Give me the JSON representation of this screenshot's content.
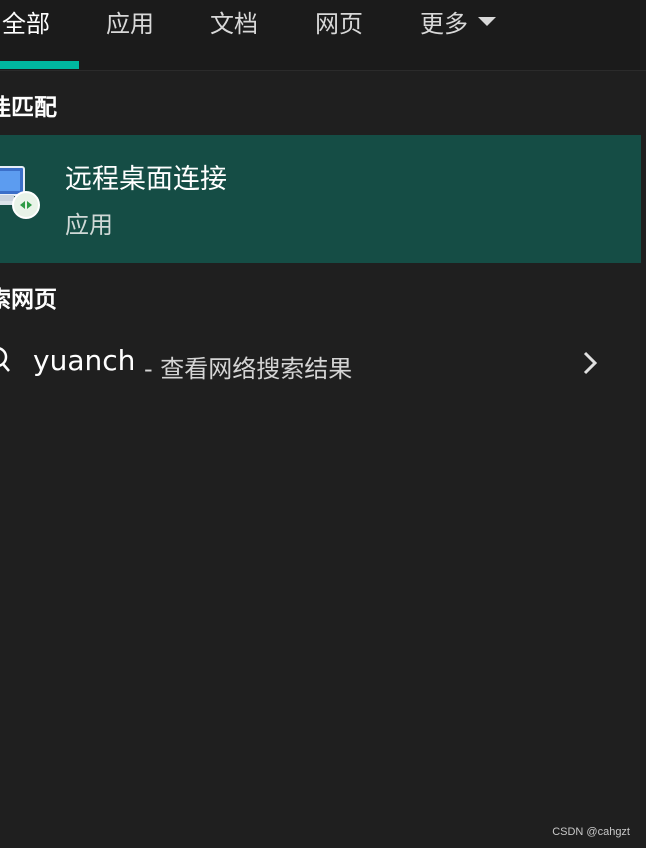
{
  "tabs": [
    {
      "label": "全部",
      "active": true
    },
    {
      "label": "应用",
      "active": false
    },
    {
      "label": "文档",
      "active": false
    },
    {
      "label": "网页",
      "active": false
    },
    {
      "label": "更多",
      "active": false
    }
  ],
  "sections": {
    "best_match_heading": "佳匹配",
    "web_search_heading": "索网页"
  },
  "best_match": {
    "title": "远程桌面连接",
    "subtitle": "应用",
    "icon": "remote-desktop-icon"
  },
  "web_search": {
    "query": "yuanch",
    "suffix": "- 查看网络搜索结果",
    "icon": "search-icon",
    "action_icon": "chevron-right-icon"
  },
  "watermark": "CSDN @cahgzt",
  "colors": {
    "background": "#1f1f1f",
    "tab_bar": "#1b1b1b",
    "accent": "#00b8a0",
    "selected_row": "#154d45"
  }
}
